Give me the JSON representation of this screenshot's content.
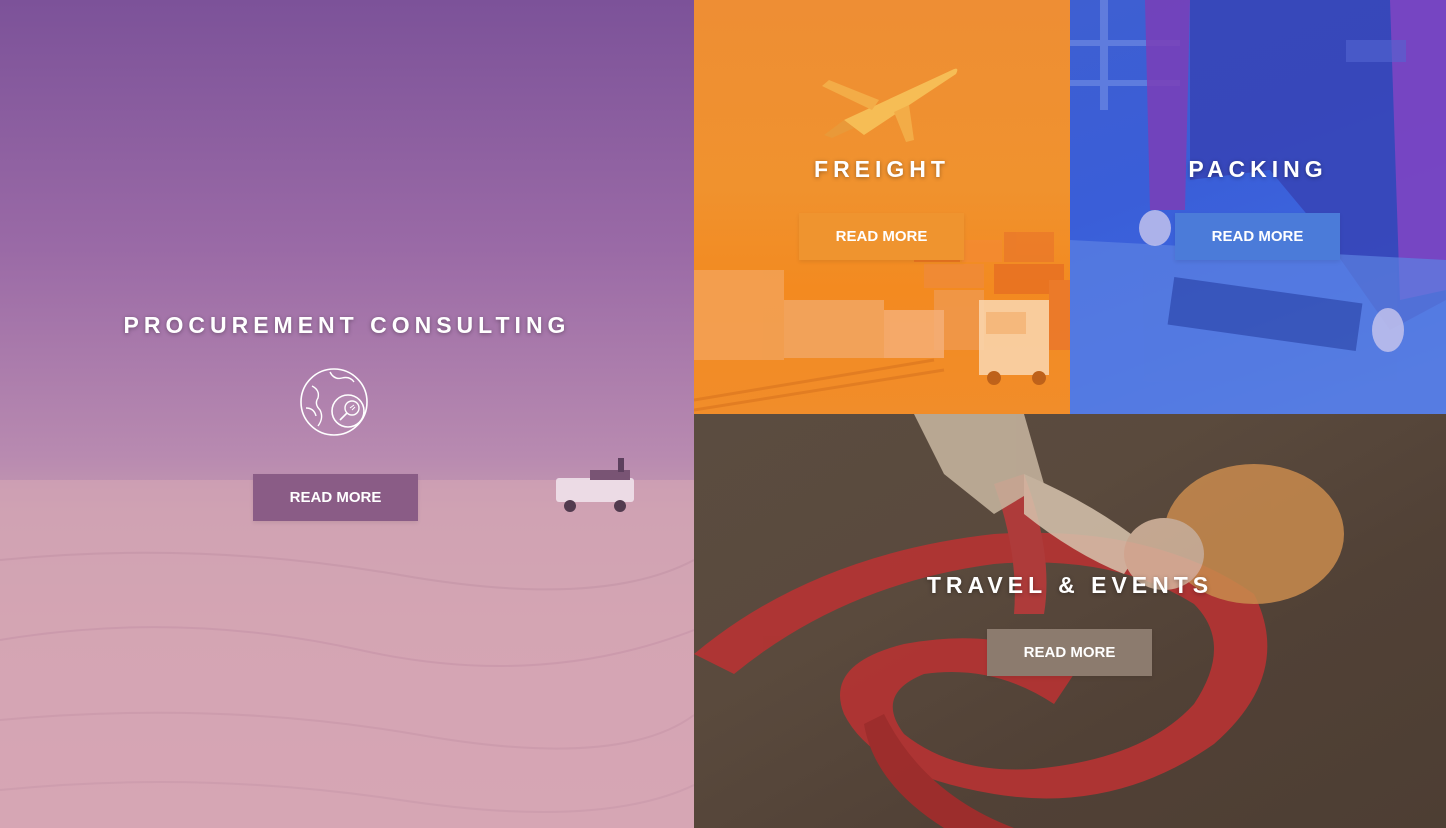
{
  "panels": {
    "procurement": {
      "title": "PROCUREMENT CONSULTING",
      "button_label": "READ MORE",
      "icon": "globe-magnifier-icon",
      "button_color": "#8a5c86"
    },
    "freight": {
      "title": "FREIGHT",
      "button_label": "READ MORE",
      "button_color": "#ef942f"
    },
    "packing": {
      "title": "PACKING",
      "button_label": "READ MORE",
      "button_color": "#4b7bd9"
    },
    "travel": {
      "title": "TRAVEL & EVENTS",
      "button_label": "READ MORE",
      "button_color": "#8c7b6e"
    }
  }
}
